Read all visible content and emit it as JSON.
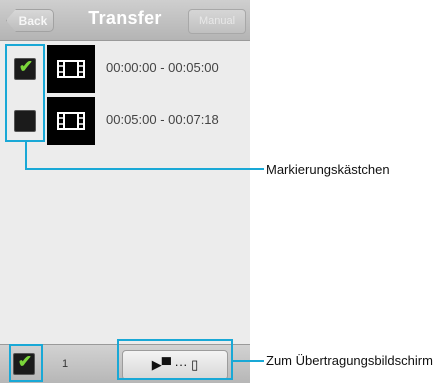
{
  "header": {
    "back_label": "Back",
    "title": "Transfer",
    "manual_label": "Manual"
  },
  "items": [
    {
      "checked": "✔",
      "time_range": "00:00:00 - 00:05:00"
    },
    {
      "checked": "",
      "time_range": "00:05:00 - 00:07:18"
    }
  ],
  "footer": {
    "select_all_check": "✔",
    "count": "1",
    "transfer_icon": "▶▀ ··· ▯"
  },
  "annotations": {
    "checkbox_label": "Markierungskästchen",
    "transfer_label": "Zum Übertragungsbildschirm"
  },
  "colors": {
    "accent": "#19a8d6",
    "check": "#7bd63a"
  }
}
